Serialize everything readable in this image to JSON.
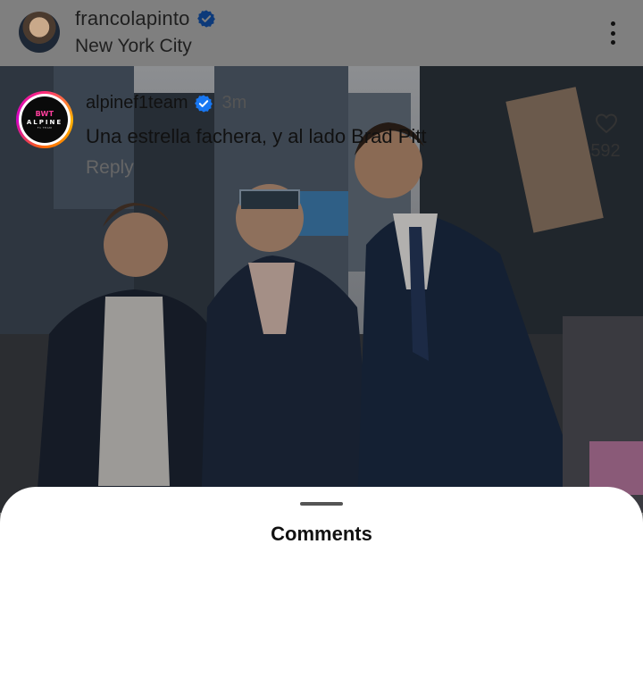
{
  "post": {
    "username": "francolapinto",
    "location": "New York City"
  },
  "comments_sheet": {
    "title": "Comments",
    "comment": {
      "username": "alpinef1team",
      "time": "3m",
      "text": "Una estrella fachera, y al lado Brad Pitt",
      "reply_label": "Reply",
      "like_count": "592"
    },
    "avatar_logo": {
      "line1": "BWT",
      "line2": "ALPINE",
      "line3": "F1 TEAM"
    }
  },
  "colors": {
    "verified_blue": "#1877f2",
    "overlay_gray": "#7f7f7f"
  },
  "icons": [
    "verified-badge-icon",
    "more-options-icon",
    "heart-icon"
  ]
}
